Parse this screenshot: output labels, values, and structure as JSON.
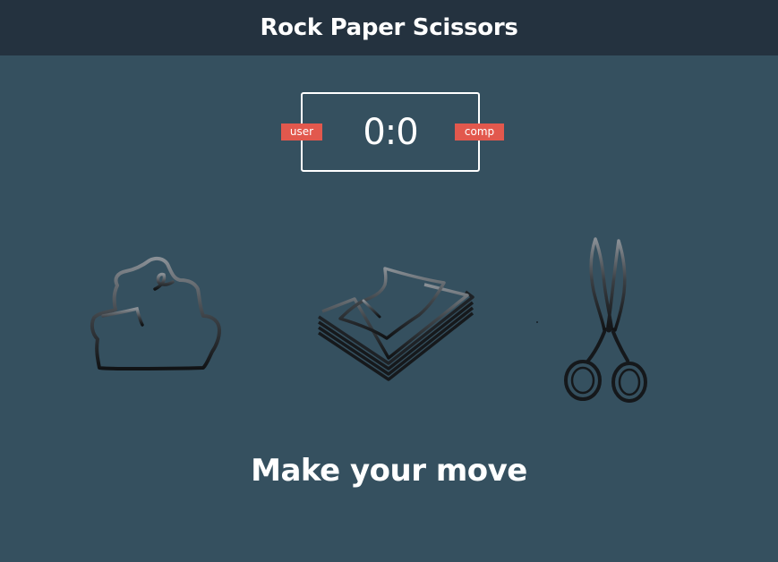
{
  "header": {
    "title": "Rock Paper Scissors"
  },
  "scoreboard": {
    "score": "0:0",
    "user_label": "user",
    "comp_label": "comp"
  },
  "choices": [
    {
      "id": "rock",
      "icon": "rock-icon"
    },
    {
      "id": "paper",
      "icon": "paper-icon"
    },
    {
      "id": "scissors",
      "icon": "scissors-icon"
    }
  ],
  "message": "Make your move",
  "colors": {
    "background": "#35505f",
    "header": "#24323f",
    "badge": "#e2584d",
    "text": "#ffffff"
  }
}
